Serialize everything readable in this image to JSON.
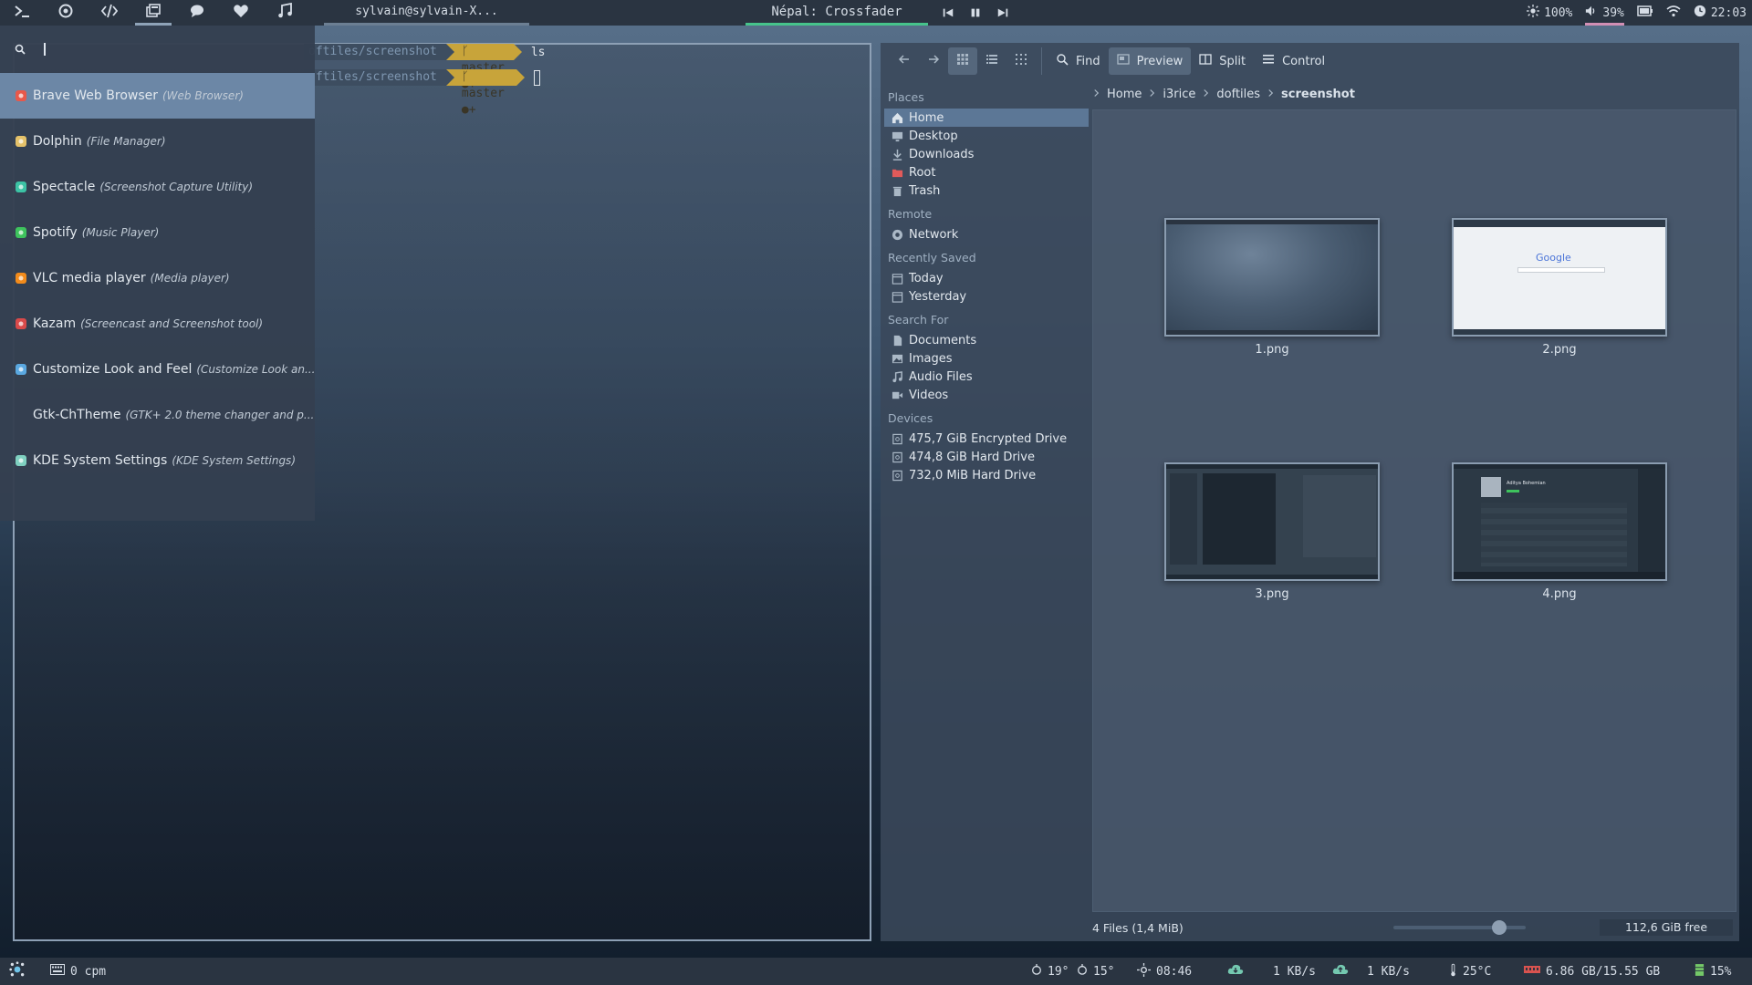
{
  "topbar": {
    "workspaces": [
      {
        "icon": "terminal-icon",
        "active": false
      },
      {
        "icon": "firefox-icon",
        "active": false
      },
      {
        "icon": "code-icon",
        "active": false
      },
      {
        "icon": "windows-icon",
        "active": true
      },
      {
        "icon": "chat-icon",
        "active": false
      },
      {
        "icon": "heart-icon",
        "active": false
      },
      {
        "icon": "music-icon",
        "active": false
      }
    ],
    "window_title": "sylvain@sylvain-X...",
    "now_playing": "Népal: Crossfader",
    "brightness": "100%",
    "volume": "39%",
    "clock": "22:03"
  },
  "launcher": {
    "search_value": "",
    "apps": [
      {
        "name": "Brave Web Browser",
        "desc": "(Web Browser)",
        "icon": "brave-icon",
        "color": "#e8584a",
        "selected": true
      },
      {
        "name": "Dolphin",
        "desc": "(File Manager)",
        "icon": "dolphin-icon",
        "color": "#e5c26a",
        "selected": false
      },
      {
        "name": "Spectacle",
        "desc": "(Screenshot Capture Utility)",
        "icon": "spectacle-icon",
        "color": "#3cc3a5",
        "selected": false
      },
      {
        "name": "Spotify",
        "desc": "(Music Player)",
        "icon": "spotify-icon",
        "color": "#3ec35d",
        "selected": false
      },
      {
        "name": "VLC media player",
        "desc": "(Media player)",
        "icon": "vlc-icon",
        "color": "#f28b1b",
        "selected": false
      },
      {
        "name": "Kazam",
        "desc": "(Screencast and Screenshot tool)",
        "icon": "kazam-icon",
        "color": "#d94a4a",
        "selected": false
      },
      {
        "name": "Customize Look and Feel",
        "desc": "(Customize Look an...",
        "icon": "customize-icon",
        "color": "#5aa8e0",
        "selected": false
      },
      {
        "name": "Gtk-ChTheme",
        "desc": "(GTK+ 2.0 theme changer and p...",
        "icon": "",
        "color": "",
        "selected": false
      },
      {
        "name": "KDE System Settings",
        "desc": "(KDE System Settings)",
        "icon": "settings-icon",
        "color": "#7fd0c0",
        "selected": false
      }
    ]
  },
  "terminal": {
    "lines": [
      {
        "path": "oftiles/screenshot",
        "git": "ᚴ master ●+",
        "command": "ls"
      },
      {
        "path": "oftiles/screenshot",
        "git": "ᚴ master ●+",
        "command": ""
      }
    ]
  },
  "dolphin": {
    "toolbar": {
      "find": "Find",
      "preview": "Preview",
      "split": "Split",
      "control": "Control"
    },
    "places_sections": [
      {
        "title": "Places",
        "items": [
          {
            "label": "Home",
            "icon": "home-icon",
            "active": true
          },
          {
            "label": "Desktop",
            "icon": "desktop-icon",
            "active": false
          },
          {
            "label": "Downloads",
            "icon": "download-icon",
            "active": false
          },
          {
            "label": "Root",
            "icon": "folder-red-icon",
            "active": false
          },
          {
            "label": "Trash",
            "icon": "trash-icon",
            "active": false
          }
        ]
      },
      {
        "title": "Remote",
        "items": [
          {
            "label": "Network",
            "icon": "network-icon",
            "active": false
          }
        ]
      },
      {
        "title": "Recently Saved",
        "items": [
          {
            "label": "Today",
            "icon": "calendar-icon",
            "active": false
          },
          {
            "label": "Yesterday",
            "icon": "calendar-icon",
            "active": false
          }
        ]
      },
      {
        "title": "Search For",
        "items": [
          {
            "label": "Documents",
            "icon": "document-icon",
            "active": false
          },
          {
            "label": "Images",
            "icon": "image-icon",
            "active": false
          },
          {
            "label": "Audio Files",
            "icon": "audio-icon",
            "active": false
          },
          {
            "label": "Videos",
            "icon": "video-icon",
            "active": false
          }
        ]
      },
      {
        "title": "Devices",
        "items": [
          {
            "label": "475,7 GiB Encrypted Drive",
            "icon": "drive-icon",
            "active": false
          },
          {
            "label": "474,8 GiB Hard Drive",
            "icon": "drive-icon",
            "active": false
          },
          {
            "label": "732,0 MiB Hard Drive",
            "icon": "drive-icon",
            "active": false
          }
        ]
      }
    ],
    "breadcrumb": [
      "Home",
      "i3rice",
      "doftiles",
      "screenshot"
    ],
    "files": [
      {
        "name": "1.png",
        "style": "blur"
      },
      {
        "name": "2.png",
        "style": "google"
      },
      {
        "name": "3.png",
        "style": "dark-ui"
      },
      {
        "name": "4.png",
        "style": "music-ui"
      }
    ],
    "thumb_google_text": "Google",
    "thumb_artist_text": "Aditya Bohemian",
    "status": "4 Files (1,4 MiB)",
    "free_space": "112,6 GiB free",
    "zoom_level": 0.8
  },
  "bottombar": {
    "cpm": "0 cpm",
    "weather_high": "19°",
    "weather_low": "15°",
    "sunrise": "08:46",
    "download": "1 KB/s",
    "upload": "1 KB/s",
    "temperature": "25°C",
    "memory": "6.86 GB/15.55 GB",
    "cpu": "15%"
  }
}
